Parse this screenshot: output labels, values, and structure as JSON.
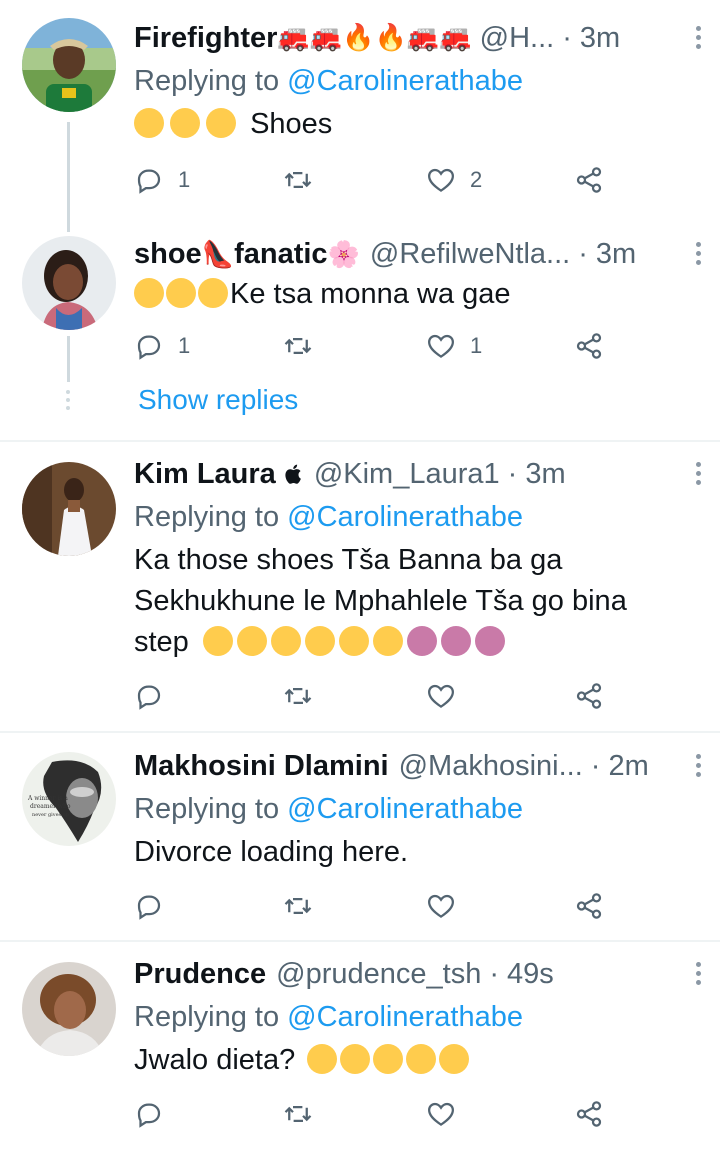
{
  "tweets": [
    {
      "name": "Firefighter",
      "name_emojis": "🚒🚒🔥🔥🚒🚒",
      "handle": "@H...",
      "time": "3m",
      "replying_prefix": "Replying to",
      "replying_to": "@Carolinerathabe",
      "text": "Shoes",
      "text_emojis": [
        "😳",
        "😳",
        "😳"
      ],
      "reply_count": "1",
      "retweet_count": "",
      "like_count": "2"
    },
    {
      "name_part1": "shoe",
      "name_emoji1": "👠",
      "name_part2": "fanatic",
      "name_emoji2": "🌸",
      "handle": "@RefilweNtla...",
      "time": "3m",
      "text": "Ke tsa monna wa gae",
      "text_emojis": [
        "😂",
        "😂",
        "😂"
      ],
      "reply_count": "1",
      "retweet_count": "",
      "like_count": "1",
      "show_replies": "Show replies"
    },
    {
      "name": "Kim Laura",
      "name_emoji": "",
      "handle": "@Kim_Laura1",
      "time": "3m",
      "replying_prefix": "Replying to",
      "replying_to": "@Carolinerathabe",
      "text_line1": "Ka those shoes Tša Banna ba ga",
      "text_line2": "Sekhukhune le Mphahlele Tša go bina",
      "text_line3": "step",
      "text_emojis": [
        "😨",
        "😨",
        "😰",
        "🥺",
        "🥺",
        "🥺",
        "🙆",
        "🙆",
        "🙆"
      ]
    },
    {
      "name": "Makhosini Dlamini",
      "handle": "@Makhosini...",
      "time": "2m",
      "replying_prefix": "Replying to",
      "replying_to": "@Carolinerathabe",
      "text": "Divorce loading here.",
      "avatar_text": "A winner is a dreamer who never gives up"
    },
    {
      "name": "Prudence",
      "handle": "@prudence_tsh",
      "time": "49s",
      "replying_prefix": "Replying to",
      "replying_to": "@Carolinerathabe",
      "text": "Jwalo dieta?",
      "text_emojis": [
        "🤣",
        "😂",
        "🤣",
        "😂",
        "🤣"
      ]
    }
  ],
  "colors": {
    "link": "#1d9bf0",
    "secondary_text": "#536471",
    "divider": "#eff3f4",
    "thread_line": "#cfd9de"
  },
  "icons": [
    "reply-icon",
    "retweet-icon",
    "like-icon",
    "share-icon",
    "more-icon"
  ]
}
